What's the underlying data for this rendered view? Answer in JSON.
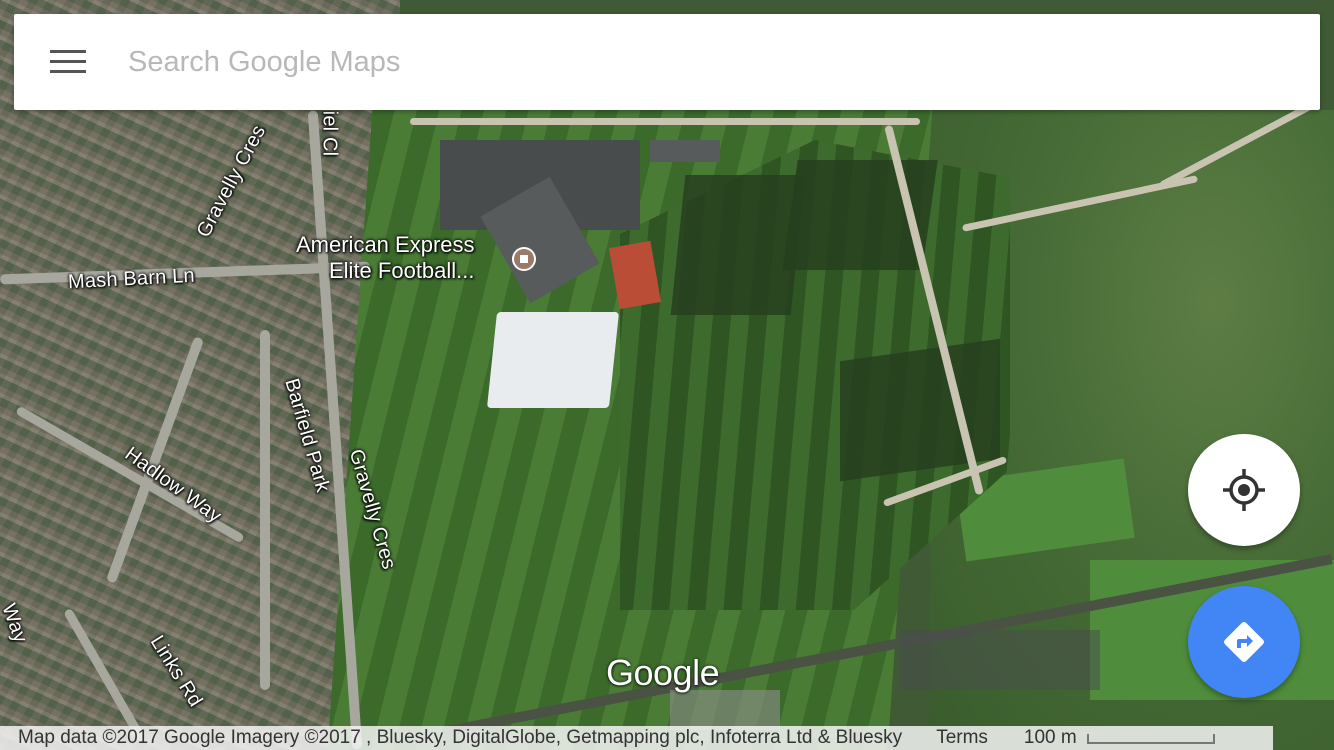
{
  "search": {
    "placeholder": "Search Google Maps"
  },
  "map": {
    "poi": {
      "line1": "American Express",
      "line2": "Elite Football..."
    },
    "street_labels": {
      "mash_barn_ln": "Mash Barn Ln",
      "gravelly_cres_top": "Gravelly Cres",
      "gravelly_cres_bottom": "Gravelly Cres",
      "barfield_park": "Barfield Park",
      "hadlow_way": "Hadlow Way",
      "links_rd": "Links Rd",
      "daniel_cl": "iel Cl",
      "way_left": "Way"
    },
    "logo": "Google"
  },
  "footer": {
    "attribution": "Map data ©2017 Google Imagery ©2017 , Bluesky, DigitalGlobe, Getmapping plc, Infoterra Ltd & Bluesky",
    "terms": "Terms",
    "scale": "100 m"
  },
  "colors": {
    "directions_button": "#4285f4",
    "location_button": "#ffffff"
  },
  "icons": {
    "menu": "hamburger-menu-icon",
    "my_location": "crosshair-location-icon",
    "directions": "directions-turn-arrow-icon"
  }
}
